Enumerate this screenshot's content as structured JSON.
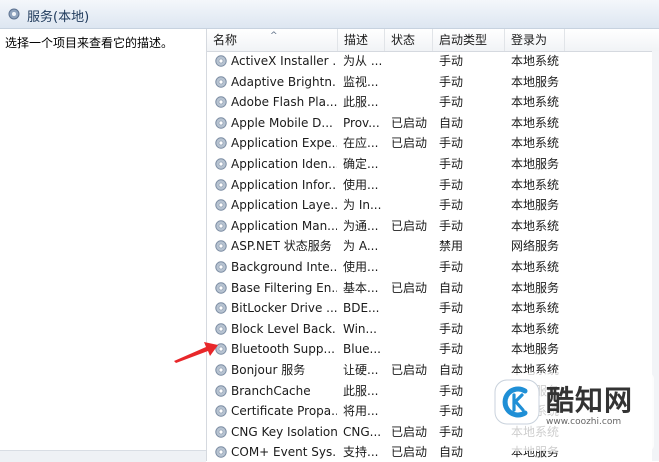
{
  "window": {
    "title": "服务(本地)"
  },
  "left_pane": {
    "description_prompt": "选择一个项目来查看它的描述。"
  },
  "columns": [
    "名称",
    "描述",
    "状态",
    "启动类型",
    "登录为"
  ],
  "rows": [
    {
      "name": "ActiveX Installer ...",
      "desc": "为从 ...",
      "status": "",
      "startup": "手动",
      "logon": "本地系统"
    },
    {
      "name": "Adaptive Brightn...",
      "desc": "监视...",
      "status": "",
      "startup": "手动",
      "logon": "本地服务"
    },
    {
      "name": "Adobe Flash Pla...",
      "desc": "此服...",
      "status": "",
      "startup": "手动",
      "logon": "本地系统"
    },
    {
      "name": "Apple Mobile D...",
      "desc": "Prov...",
      "status": "已启动",
      "startup": "自动",
      "logon": "本地系统"
    },
    {
      "name": "Application Expe...",
      "desc": "在应...",
      "status": "已启动",
      "startup": "手动",
      "logon": "本地系统"
    },
    {
      "name": "Application Iden...",
      "desc": "确定...",
      "status": "",
      "startup": "手动",
      "logon": "本地服务"
    },
    {
      "name": "Application Infor...",
      "desc": "使用...",
      "status": "",
      "startup": "手动",
      "logon": "本地系统"
    },
    {
      "name": "Application Laye...",
      "desc": "为 In...",
      "status": "",
      "startup": "手动",
      "logon": "本地服务"
    },
    {
      "name": "Application Man...",
      "desc": "为通...",
      "status": "已启动",
      "startup": "手动",
      "logon": "本地系统"
    },
    {
      "name": "ASP.NET 状态服务",
      "desc": "为 A...",
      "status": "",
      "startup": "禁用",
      "logon": "网络服务"
    },
    {
      "name": "Background Inte...",
      "desc": "使用...",
      "status": "",
      "startup": "手动",
      "logon": "本地系统"
    },
    {
      "name": "Base Filtering En...",
      "desc": "基本...",
      "status": "已启动",
      "startup": "自动",
      "logon": "本地服务"
    },
    {
      "name": "BitLocker Drive ...",
      "desc": "BDE...",
      "status": "",
      "startup": "手动",
      "logon": "本地系统"
    },
    {
      "name": "Block Level Back...",
      "desc": "Win...",
      "status": "",
      "startup": "手动",
      "logon": "本地系统"
    },
    {
      "name": "Bluetooth Supp...",
      "desc": "Blue...",
      "status": "",
      "startup": "手动",
      "logon": "本地服务"
    },
    {
      "name": "Bonjour 服务",
      "desc": "让硬...",
      "status": "已启动",
      "startup": "自动",
      "logon": "本地系统"
    },
    {
      "name": "BranchCache",
      "desc": "此服...",
      "status": "",
      "startup": "手动",
      "logon": "网络服务"
    },
    {
      "name": "Certificate Propa...",
      "desc": "将用...",
      "status": "",
      "startup": "手动",
      "logon": "本地系统"
    },
    {
      "name": "CNG Key Isolation",
      "desc": "CNG...",
      "status": "已启动",
      "startup": "手动",
      "logon": "本地系统"
    },
    {
      "name": "COM+ Event Sys...",
      "desc": "支持...",
      "status": "已启动",
      "startup": "自动",
      "logon": "本地服务"
    }
  ],
  "watermark": {
    "brand": "酷知网",
    "url": "www.coozhi.com"
  },
  "colors": {
    "arrow": "#e8272a",
    "title_text": "#1e395b",
    "logo_accent": "#1f8fd6"
  }
}
